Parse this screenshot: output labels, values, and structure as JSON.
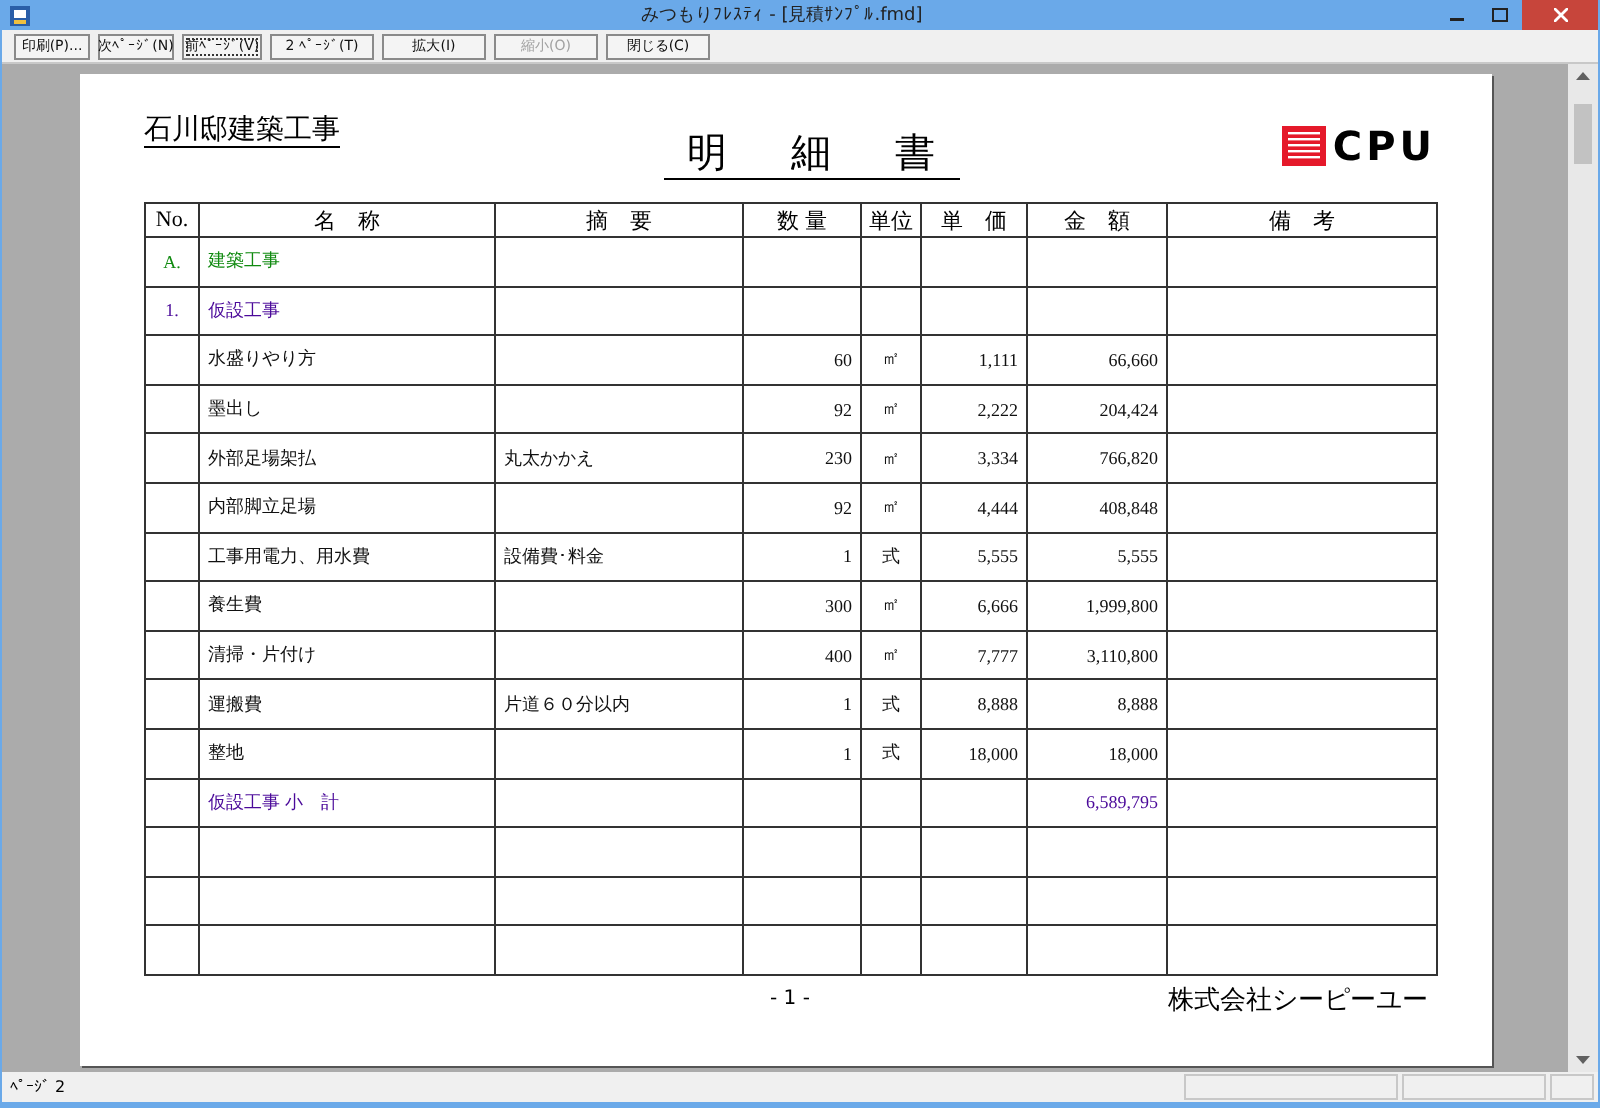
{
  "window": {
    "title": "みつもりﾌﾚｽﾃｨ - [見積ｻﾝﾌﾟﾙ.fmd]"
  },
  "toolbar": [
    {
      "label": "印刷(P)...",
      "disabled": false,
      "focused": false
    },
    {
      "label": "次ﾍﾟｰｼﾞ(N)",
      "disabled": false,
      "focused": false
    },
    {
      "label": "前ﾍﾟｰｼﾞ(V)",
      "disabled": false,
      "focused": true
    },
    {
      "label": "2 ﾍﾟｰｼﾞ(T)",
      "disabled": false,
      "focused": false
    },
    {
      "label": "拡大(I)",
      "disabled": false,
      "focused": false
    },
    {
      "label": "縮小(O)",
      "disabled": true,
      "focused": false
    },
    {
      "label": "閉じる(C)",
      "disabled": false,
      "focused": false
    }
  ],
  "document": {
    "client": "石川邸建築工事",
    "title": "明　細　書",
    "logo": "CPU",
    "columns": [
      "No.",
      "名　称",
      "摘　要",
      "数 量",
      "単位",
      "単　価",
      "金　額",
      "備　考"
    ],
    "rows": [
      {
        "kind": "section",
        "no": "A.",
        "name": "建築工事"
      },
      {
        "kind": "group",
        "no": "1.",
        "name": "仮設工事"
      },
      {
        "kind": "item",
        "name": "水盛りやり方",
        "qty": "60",
        "unit": "㎡",
        "price": "1,111",
        "amount": "66,660"
      },
      {
        "kind": "item",
        "name": "墨出し",
        "qty": "92",
        "unit": "㎡",
        "price": "2,222",
        "amount": "204,424"
      },
      {
        "kind": "item",
        "name": "外部足場架払",
        "note": "丸太かかえ",
        "qty": "230",
        "unit": "㎡",
        "price": "3,334",
        "amount": "766,820"
      },
      {
        "kind": "item",
        "name": "内部脚立足場",
        "qty": "92",
        "unit": "㎡",
        "price": "4,444",
        "amount": "408,848"
      },
      {
        "kind": "item",
        "name": "工事用電力、用水費",
        "note": "設備費･料金",
        "qty": "1",
        "unit": "式",
        "price": "5,555",
        "amount": "5,555"
      },
      {
        "kind": "item",
        "name": "養生費",
        "qty": "300",
        "unit": "㎡",
        "price": "6,666",
        "amount": "1,999,800"
      },
      {
        "kind": "item",
        "name": "清掃・片付け",
        "qty": "400",
        "unit": "㎡",
        "price": "7,777",
        "amount": "3,110,800"
      },
      {
        "kind": "item",
        "name": "運搬費",
        "note": "片道６０分以内",
        "qty": "1",
        "unit": "式",
        "price": "8,888",
        "amount": "8,888"
      },
      {
        "kind": "item",
        "name": "整地",
        "qty": "1",
        "unit": "式",
        "price": "18,000",
        "amount": "18,000"
      },
      {
        "kind": "subtotal",
        "name": "仮設工事 小　計",
        "amount": "6,589,795"
      },
      {
        "kind": "blank"
      },
      {
        "kind": "blank"
      },
      {
        "kind": "blank"
      }
    ],
    "page_number": "- 1 -",
    "company": "株式会社シーピーユー"
  },
  "status_bar": {
    "page": "ﾍﾟｰｼﾞ 2"
  }
}
